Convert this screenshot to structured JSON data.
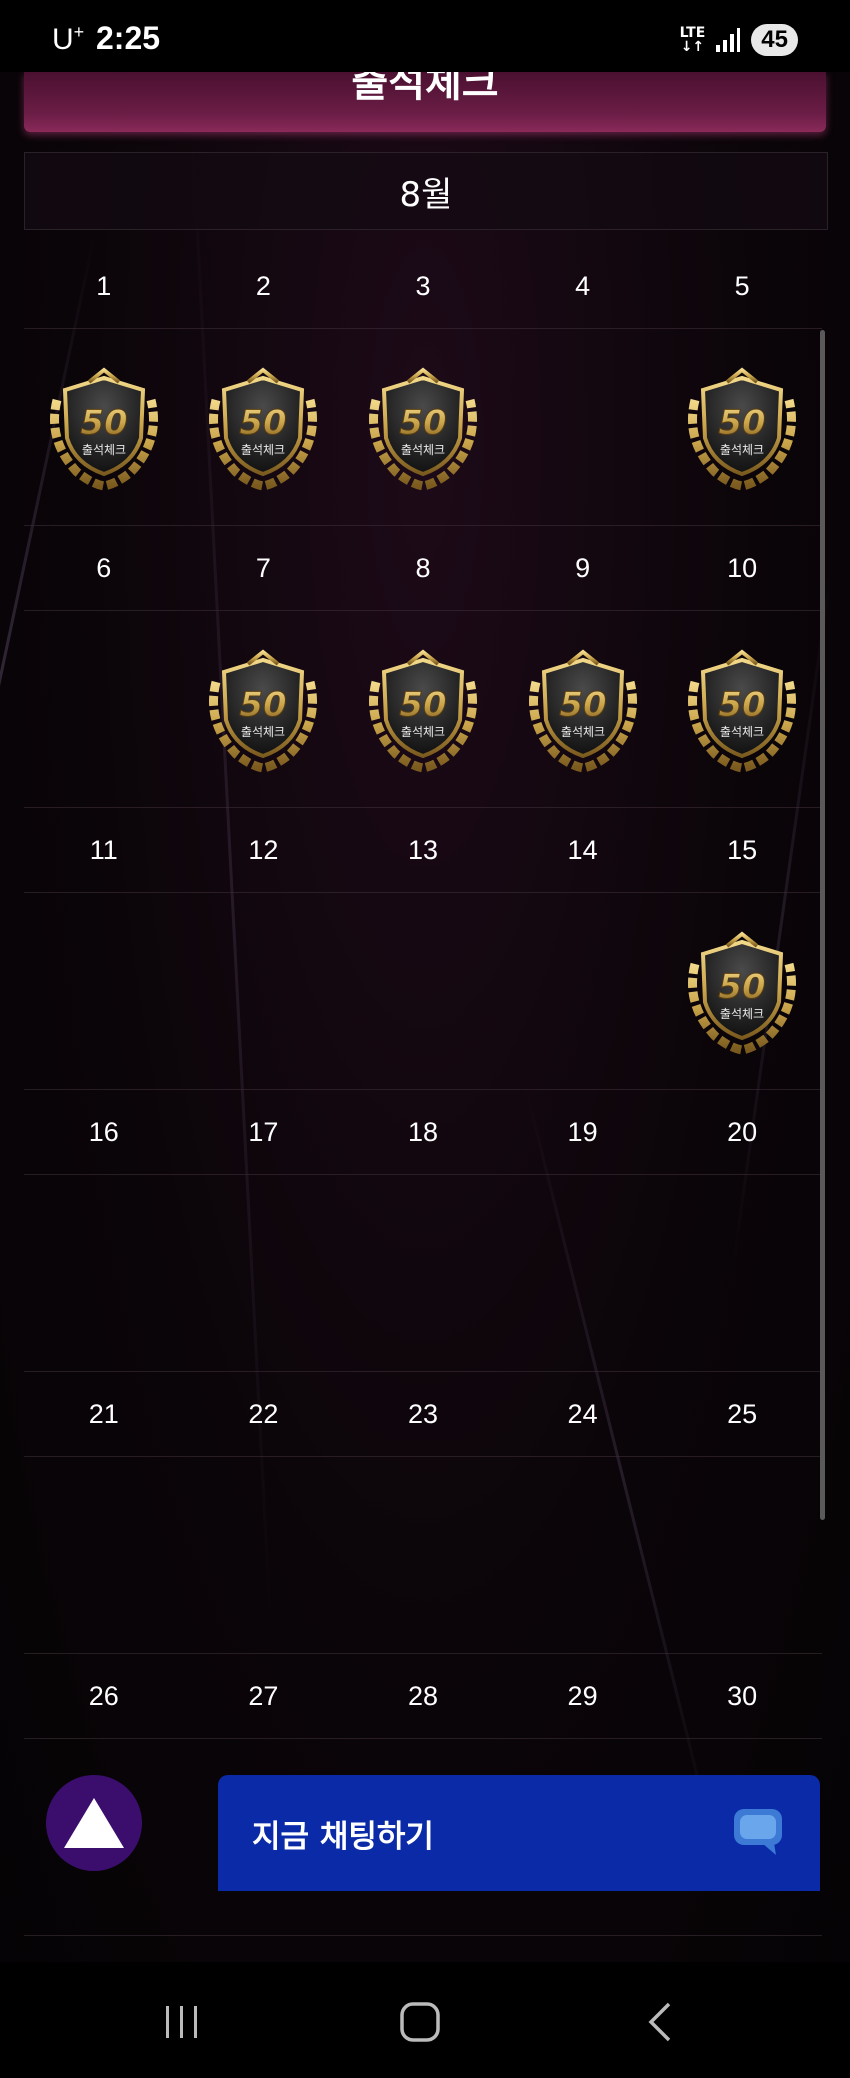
{
  "status_bar": {
    "carrier": "U",
    "carrier_sup": "+",
    "time": "2:25",
    "network": "LTE",
    "battery": "45"
  },
  "header": {
    "title": "출석체크"
  },
  "calendar": {
    "month": "8월",
    "stamp_text": "출석체크",
    "stamp_number": "50",
    "weeks": [
      {
        "days": [
          "1",
          "2",
          "3",
          "4",
          "5"
        ],
        "stamped": [
          true,
          true,
          true,
          false,
          true
        ]
      },
      {
        "days": [
          "6",
          "7",
          "8",
          "9",
          "10"
        ],
        "stamped": [
          false,
          true,
          true,
          true,
          true
        ]
      },
      {
        "days": [
          "11",
          "12",
          "13",
          "14",
          "15"
        ],
        "stamped": [
          false,
          false,
          false,
          false,
          true
        ]
      },
      {
        "days": [
          "16",
          "17",
          "18",
          "19",
          "20"
        ],
        "stamped": [
          false,
          false,
          false,
          false,
          false
        ]
      },
      {
        "days": [
          "21",
          "22",
          "23",
          "24",
          "25"
        ],
        "stamped": [
          false,
          false,
          false,
          false,
          false
        ]
      },
      {
        "days": [
          "26",
          "27",
          "28",
          "29",
          "30"
        ],
        "stamped": [
          false,
          false,
          false,
          false,
          false
        ]
      }
    ]
  },
  "chat_button": {
    "label": "지금 채팅하기",
    "icon": "chat-bubble-icon"
  },
  "fab": {
    "icon": "up-triangle-icon"
  },
  "nav_bar": {
    "recent": "recent-apps-icon",
    "home": "home-icon",
    "back": "back-icon"
  },
  "colors": {
    "banner": "#6b1d46",
    "chat_button": "#0a2aa8",
    "fab": "#3b0e6e",
    "stamp_gold": "#c9a44a"
  }
}
